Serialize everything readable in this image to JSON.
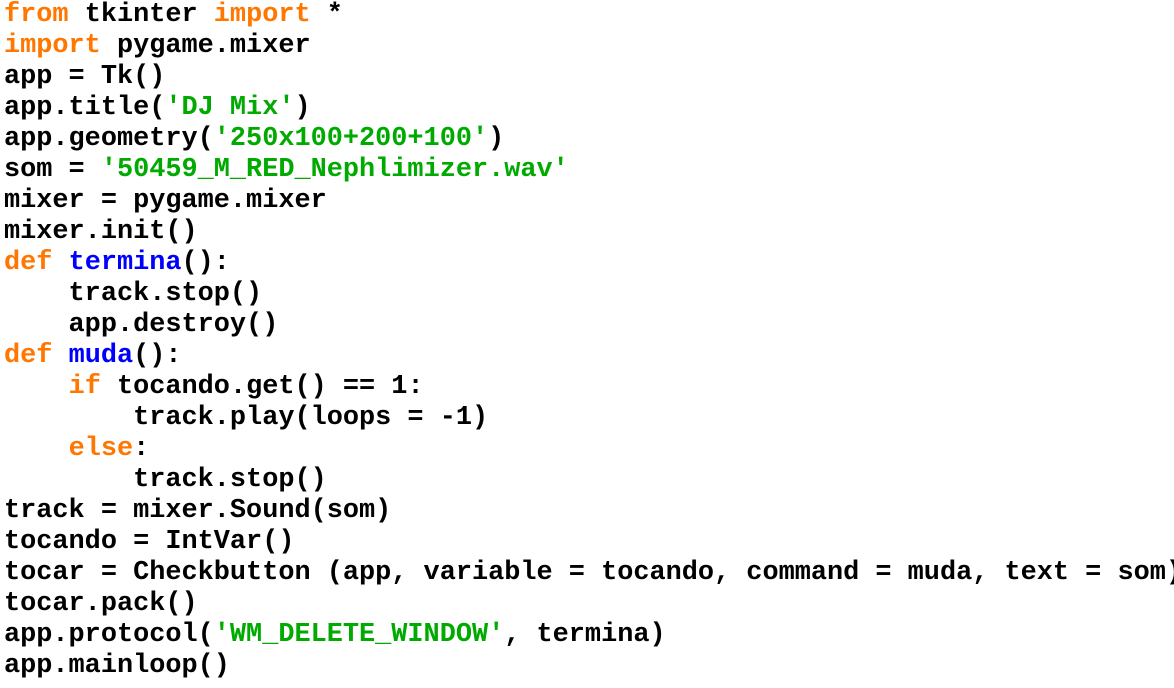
{
  "colors": {
    "keyword": "#ff7700",
    "string": "#00aa00",
    "definition": "#0000ff",
    "default": "#000000",
    "background": "#ffffff"
  },
  "lines": [
    [
      {
        "t": "from",
        "c": "kw"
      },
      {
        "t": " tkinter ",
        "c": "pl"
      },
      {
        "t": "import",
        "c": "kw"
      },
      {
        "t": " *",
        "c": "pl"
      }
    ],
    [
      {
        "t": "import",
        "c": "kw"
      },
      {
        "t": " pygame.mixer",
        "c": "pl"
      }
    ],
    [
      {
        "t": "app = Tk()",
        "c": "pl"
      }
    ],
    [
      {
        "t": "app.title(",
        "c": "pl"
      },
      {
        "t": "'DJ Mix'",
        "c": "str"
      },
      {
        "t": ")",
        "c": "pl"
      }
    ],
    [
      {
        "t": "app.geometry(",
        "c": "pl"
      },
      {
        "t": "'250x100+200+100'",
        "c": "str"
      },
      {
        "t": ")",
        "c": "pl"
      }
    ],
    [
      {
        "t": "som = ",
        "c": "pl"
      },
      {
        "t": "'50459_M_RED_Nephlimizer.wav'",
        "c": "str"
      }
    ],
    [
      {
        "t": "mixer = pygame.mixer",
        "c": "pl"
      }
    ],
    [
      {
        "t": "mixer.init()",
        "c": "pl"
      }
    ],
    [
      {
        "t": "def",
        "c": "kw"
      },
      {
        "t": " ",
        "c": "pl"
      },
      {
        "t": "termina",
        "c": "def"
      },
      {
        "t": "():",
        "c": "pl"
      }
    ],
    [
      {
        "t": "    track.stop()",
        "c": "pl"
      }
    ],
    [
      {
        "t": "    app.destroy()",
        "c": "pl"
      }
    ],
    [
      {
        "t": "def",
        "c": "kw"
      },
      {
        "t": " ",
        "c": "pl"
      },
      {
        "t": "muda",
        "c": "def"
      },
      {
        "t": "():",
        "c": "pl"
      }
    ],
    [
      {
        "t": "    ",
        "c": "pl"
      },
      {
        "t": "if",
        "c": "kw"
      },
      {
        "t": " tocando.get() == 1:",
        "c": "pl"
      }
    ],
    [
      {
        "t": "        track.play(loops = -1)",
        "c": "pl"
      }
    ],
    [
      {
        "t": "    ",
        "c": "pl"
      },
      {
        "t": "else",
        "c": "kw"
      },
      {
        "t": ":",
        "c": "pl"
      }
    ],
    [
      {
        "t": "        track.stop()",
        "c": "pl"
      }
    ],
    [
      {
        "t": "track = mixer.Sound(som)",
        "c": "pl"
      }
    ],
    [
      {
        "t": "tocando = IntVar()",
        "c": "pl"
      }
    ],
    [
      {
        "t": "tocar = Checkbutton (app, variable = tocando, command = muda, text = som)",
        "c": "pl"
      }
    ],
    [
      {
        "t": "tocar.pack()",
        "c": "pl"
      }
    ],
    [
      {
        "t": "app.protocol(",
        "c": "pl"
      },
      {
        "t": "'WM_DELETE_WINDOW'",
        "c": "str"
      },
      {
        "t": ", termina)",
        "c": "pl"
      }
    ],
    [
      {
        "t": "app.mainloop()",
        "c": "pl"
      }
    ]
  ]
}
